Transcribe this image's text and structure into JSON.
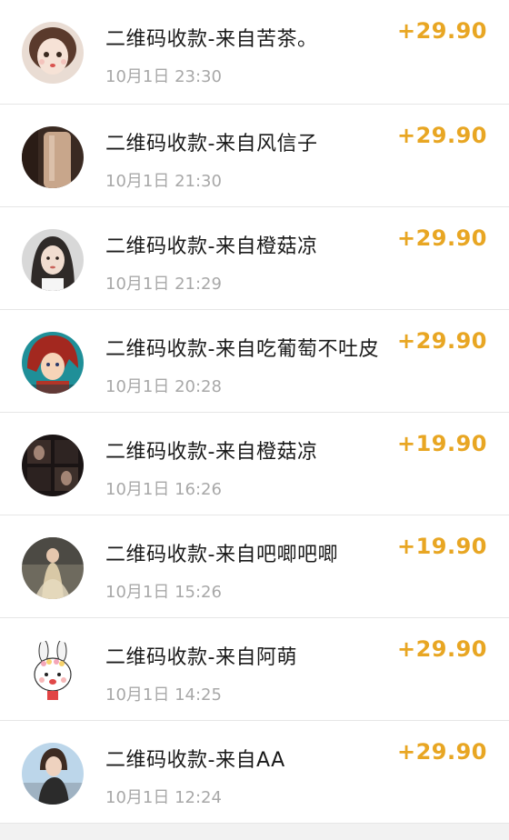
{
  "transactions": [
    {
      "title": "二维码收款-来自苦茶。",
      "time": "10月1日 23:30",
      "amount": "+29.90",
      "avatar": "girl-cartoon-avatar"
    },
    {
      "title": "二维码收款-来自风信子",
      "time": "10月1日 21:30",
      "amount": "+29.90",
      "avatar": "photo-avatar"
    },
    {
      "title": "二维码收款-来自橙菇凉",
      "time": "10月1日 21:29",
      "amount": "+29.90",
      "avatar": "photo-avatar"
    },
    {
      "title": "二维码收款-来自吃葡萄不吐皮",
      "time": "10月1日 20:28",
      "amount": "+29.90",
      "avatar": "anime-avatar"
    },
    {
      "title": "二维码收款-来自橙菇凉",
      "time": "10月1日 16:26",
      "amount": "+19.90",
      "avatar": "photo-avatar"
    },
    {
      "title": "二维码收款-来自吧唧吧唧",
      "time": "10月1日 15:26",
      "amount": "+19.90",
      "avatar": "photo-avatar"
    },
    {
      "title": "二维码收款-来自阿萌",
      "time": "10月1日 14:25",
      "amount": "+29.90",
      "avatar": "bunny-cartoon-avatar"
    },
    {
      "title": "二维码收款-来自AA",
      "time": "10月1日 12:24",
      "amount": "+29.90",
      "avatar": "photo-avatar"
    }
  ],
  "colors": {
    "amount": "#e8a623",
    "title": "#1a1a1a",
    "time": "#a8a8a8"
  }
}
